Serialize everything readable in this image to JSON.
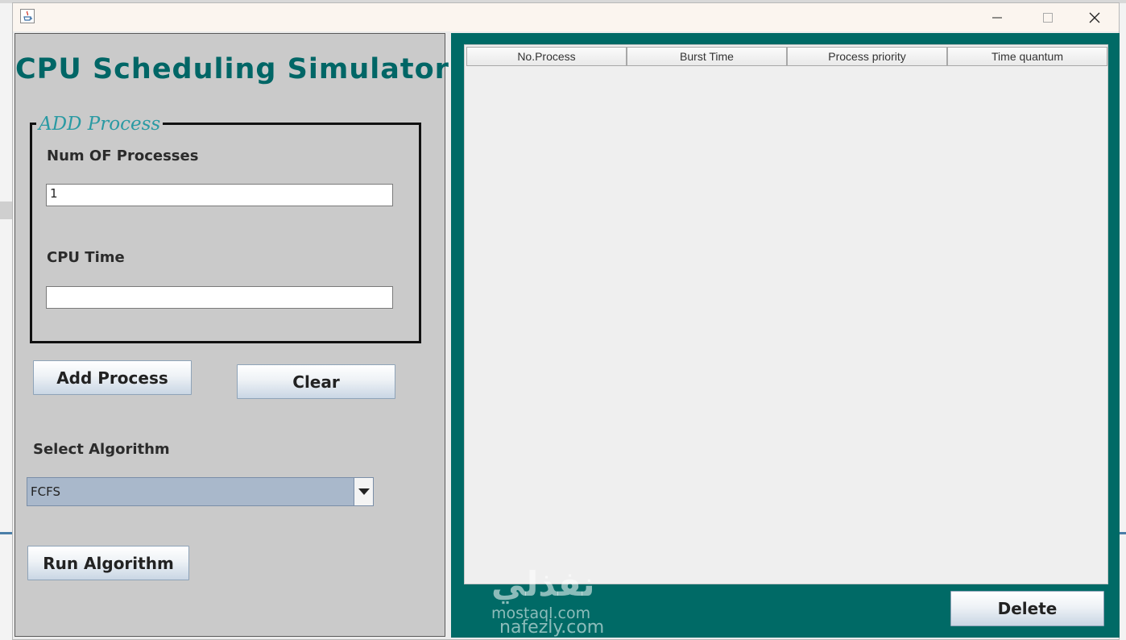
{
  "app": {
    "title": "CPU Scheduling Simulator"
  },
  "add_process_group": {
    "title": "ADD Process",
    "num_processes_label": "Num OF Processes",
    "num_processes_value": "1",
    "cpu_time_label": "CPU Time",
    "cpu_time_value": ""
  },
  "buttons": {
    "add_process": "Add Process",
    "clear": "Clear",
    "run_algorithm": "Run Algorithm",
    "delete": "Delete"
  },
  "algorithm": {
    "label": "Select Algorithm",
    "selected": "FCFS"
  },
  "table": {
    "columns": [
      "No.Process",
      "Burst Time",
      "Process priority",
      "Time quantum"
    ],
    "rows": []
  },
  "watermark": {
    "logo": "نفذلي",
    "line1": "mostaql.com",
    "line2": "nafezly.com"
  },
  "colors": {
    "accent": "#006666",
    "panel": "#cacaca",
    "right_panel": "#006a66",
    "group_title": "#2a9aa3"
  },
  "icons": {
    "window": "java-app-icon",
    "minimize": "minimize-icon",
    "maximize": "maximize-icon",
    "close": "close-icon",
    "dropdown": "chevron-down-icon"
  }
}
